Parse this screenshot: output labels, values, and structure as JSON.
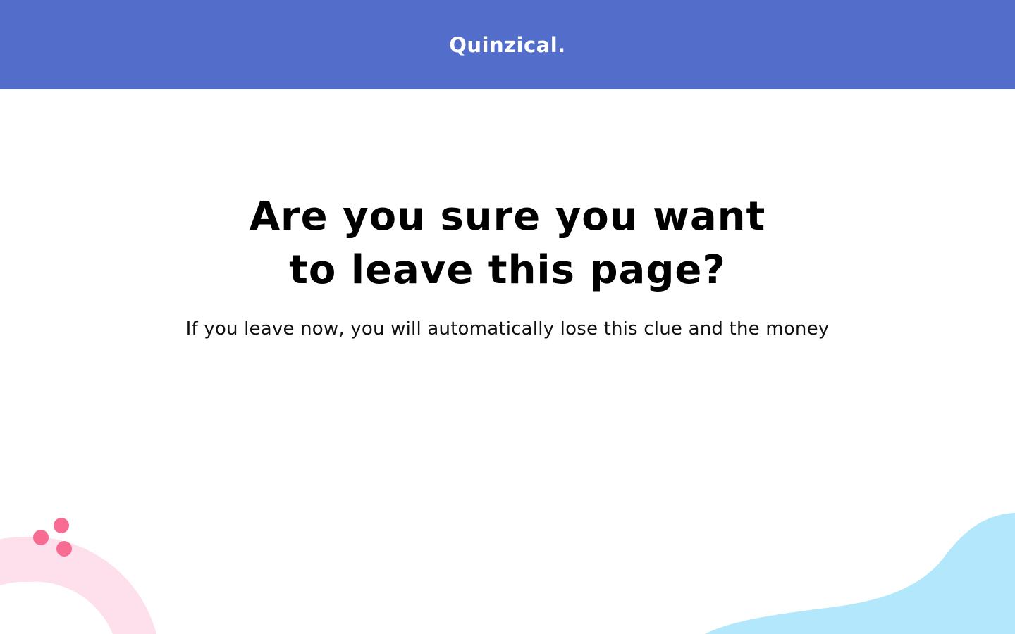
{
  "header": {
    "brand": "Quinzical.",
    "background_color": "#536dca"
  },
  "dialog": {
    "title_line_1": "Are you sure you want",
    "title_line_2": "to leave this page?",
    "message": "If you leave now, you will automatically lose this clue and the money"
  },
  "decorations": {
    "arc_color": "#fde0ec",
    "dots_color": "#f86b93",
    "blob_color": "#b3e7fb"
  }
}
